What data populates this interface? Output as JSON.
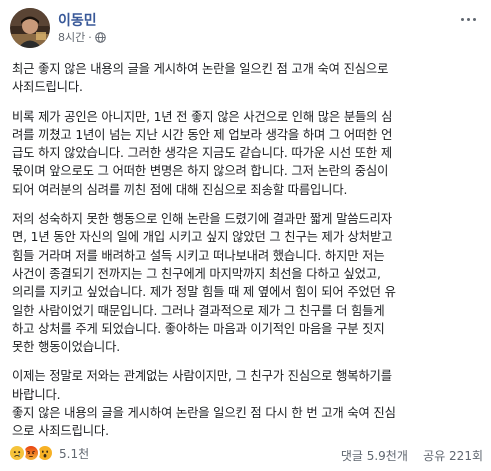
{
  "post": {
    "author": "이동민",
    "time": "8시간",
    "privacy_icon": "globe-icon",
    "more_icon": "more-options-icon",
    "paragraphs": [
      "최근 좋지 않은 내용의 글을 게시하여 논란을 일으킨 점 고개 숙여 진심으로\n사죄드립니다.",
      "비록 제가 공인은 아니지만, 1년 전 좋지 않은 사건으로 인해 많은 분들의 심\n려를 끼쳤고 1년이 넘는 지난 시간 동안 제 업보라 생각을 하며 그 어떠한 언\n급도 하지 않았습니다. 그러한 생각은 지금도 같습니다. 따가운 시선 또한 제\n몫이며 앞으로도 그 어떠한 변명은 하지 않으려 합니다. 그저 논란의 중심이\n되어 여러분의 심려를 끼친 점에 대해 진심으로 죄송할 따름입니다.",
      "저의 성숙하지 못한 행동으로 인해 논란을 드렸기에 결과만 짧게 말씀드리자\n면, 1년 동안 자신의 일에 개입 시키고 싶지 않았던 그 친구는 제가 상처받고\n힘들 거라며 저를 배려하고 설득 시키고 떠나보내려 했습니다. 하지만 저는\n사건이 종결되기 전까지는 그 친구에게 마지막까지 최선을 다하고 싶었고,\n의리를 지키고 싶었습니다. 제가 정말 힘들 때 제 옆에서 힘이 되어 주었던 유\n일한 사람이었기 때문입니다. 그러나 결과적으로 제가 그 친구를 더 힘들게\n하고 상처를 주게 되었습니다. 좋아하는 마음과 이기적인 마음을 구분 짓지\n못한 행동이었습니다.",
      "이제는 정말로 저와는 관계없는 사람이지만, 그 친구가 진심으로 행복하기를\n바랍니다.\n좋지 않은 내용의 글을 게시하여 논란을 일으킨 점 다시 한 번 고개 숙여 진심\n으로 사죄드립니다."
    ]
  },
  "footer": {
    "reaction_icons": [
      "sad-reaction-icon",
      "angry-reaction-icon",
      "wow-reaction-icon"
    ],
    "reaction_count": "5.1천",
    "comments": "댓글 5.9천개",
    "shares": "공유 221회"
  },
  "colors": {
    "author": "#385898",
    "sad": "#f5c33b",
    "angry": "#e9710f",
    "wow": "#f7b125"
  }
}
